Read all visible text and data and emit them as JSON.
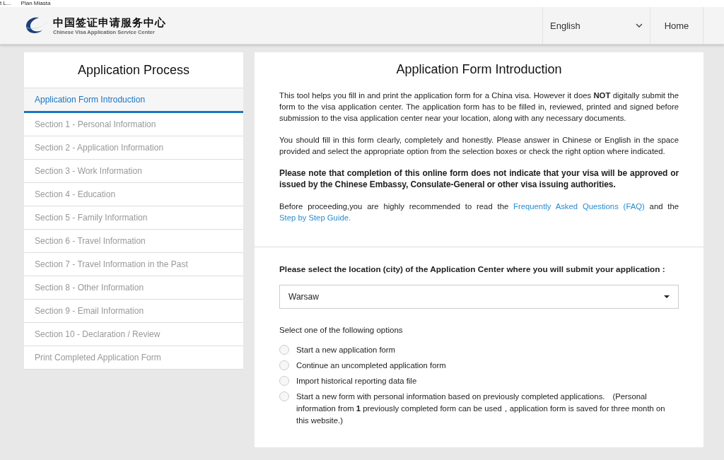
{
  "bookmarks": [
    "t L...",
    "Plan Miasta"
  ],
  "header": {
    "logo_title": "中国签证申请服务中心",
    "logo_subtitle": "Chinese Visa Application Service Center",
    "language": "English",
    "home": "Home"
  },
  "sidebar": {
    "title": "Application Process",
    "items": [
      {
        "label": "Application Form Introduction",
        "selected": true
      },
      {
        "label": "Section 1 - Personal Information",
        "selected": false
      },
      {
        "label": "Section 2 - Application Information",
        "selected": false
      },
      {
        "label": "Section 3 - Work Information",
        "selected": false
      },
      {
        "label": "Section 4 - Education",
        "selected": false
      },
      {
        "label": "Section 5 - Family Information",
        "selected": false
      },
      {
        "label": "Section 6 - Travel Information",
        "selected": false
      },
      {
        "label": "Section 7 - Travel Information in the Past",
        "selected": false
      },
      {
        "label": "Section 8 - Other Information",
        "selected": false
      },
      {
        "label": "Section 9 - Email Information",
        "selected": false
      },
      {
        "label": "Section 10 - Declaration / Review",
        "selected": false
      },
      {
        "label": "Print Completed Application Form",
        "selected": false
      }
    ]
  },
  "main": {
    "title": "Application Form Introduction",
    "paragraphs": [
      {
        "kind": "plain",
        "text": "This tool helps you fill in and print the application form for a China visa. However it does **NOT** digitally submit the form to the visa application center. The application form has to be filled in, reviewed, printed and signed before submission to the visa application center near your location, along with any necessary documents."
      },
      {
        "kind": "plain",
        "text": "You should fill in this form clearly, completely and honestly. Please answer in Chinese or English in the space provided and select the appropriate option from the selection boxes or check the right option where indicated."
      },
      {
        "kind": "bold",
        "text": "Please note that completion of this online form does not indicate that your visa will be approved or issued by the Chinese Embassy, Consulate-General or other visa issuing authorities."
      },
      {
        "kind": "links",
        "parts": [
          {
            "text": "Before proceeding,you are highly recommended to read the ",
            "kind": "text"
          },
          {
            "text": "Frequently Asked Questions (FAQ)",
            "kind": "link"
          },
          {
            "text": " and the ",
            "kind": "text"
          },
          {
            "text": "Step by Step Guide.",
            "kind": "link"
          }
        ]
      }
    ],
    "location_label": "Please select the location (city) of the Application Center where you will submit your application :",
    "location_value": "Warsaw",
    "options_label": "Select one of the following options",
    "options": [
      {
        "text": "Start a new application form",
        "selected": false
      },
      {
        "text": "Continue an uncompleted application form",
        "selected": false
      },
      {
        "text": "Import historical reporting data file",
        "selected": false
      },
      {
        "text": "Start a new form with personal information based on previously completed applications.　(Personal information from **1** previously completed form can be used，application form is saved for three month on this website.)",
        "selected": false
      }
    ]
  }
}
